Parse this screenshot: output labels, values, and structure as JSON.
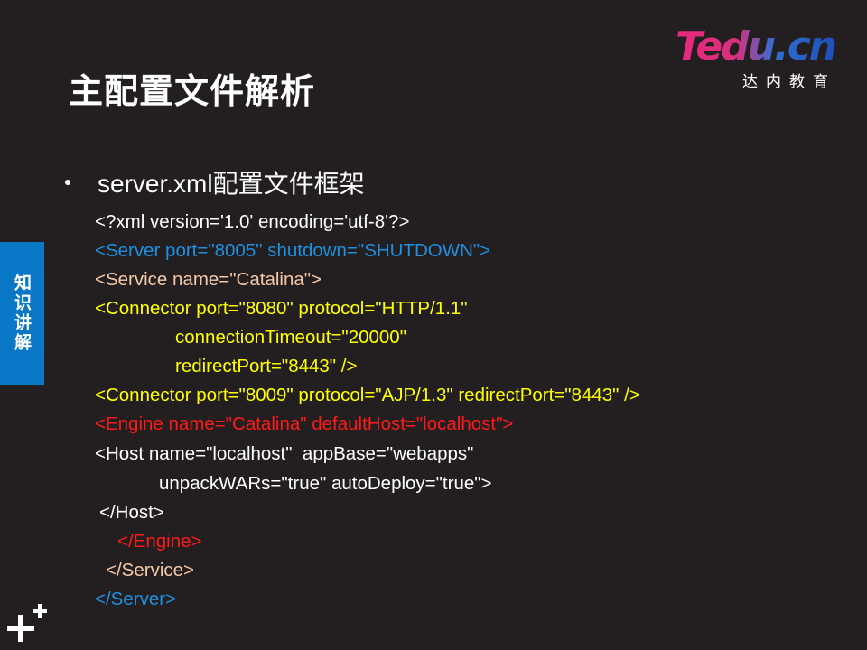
{
  "slide": {
    "title": "主配置文件解析",
    "brand": {
      "logo_text": "Tedu.cn",
      "logo_subtitle": "达内教育"
    },
    "side_tab": "知识讲解",
    "bullet": {
      "text": "server.xml配置文件框架"
    },
    "code_lines": [
      {
        "text": "<?xml version='1.0' encoding='utf-8'?>",
        "color": "#ffffff"
      },
      {
        "text": "<Server port=\"8005\" shutdown=\"SHUTDOWN\">",
        "color": "#1e90e0"
      },
      {
        "text": "<Service name=\"Catalina\">",
        "color": "#f5c8a8"
      },
      {
        "text": "<Connector port=\"8080\" protocol=\"HTTP/1.1\"",
        "color": "#ffff00"
      },
      {
        "text": "connectionTimeout=\"20000\"",
        "color": "#ffff00"
      },
      {
        "text": "redirectPort=\"8443\" />",
        "color": "#ffff00"
      },
      {
        "text": "<Connector port=\"8009\" protocol=\"AJP/1.3\" redirectPort=\"8443\" />",
        "color": "#ffff00"
      },
      {
        "text": "<Engine name=\"Catalina\" defaultHost=\"localhost\">",
        "color": "#ff1a1a"
      },
      {
        "text": "<Host name=\"localhost\"  appBase=\"webapps\"",
        "color": "#ffffff"
      },
      {
        "text": "unpackWARs=\"true\" autoDeploy=\"true\">",
        "color": "#ffffff"
      },
      {
        "text": "</Host>",
        "color": "#ffffff"
      },
      {
        "text": "</Engine>",
        "color": "#ff1a1a"
      },
      {
        "text": "</Service>",
        "color": "#f5c8a8"
      },
      {
        "text": "</Server>",
        "color": "#1e90e0"
      }
    ]
  }
}
